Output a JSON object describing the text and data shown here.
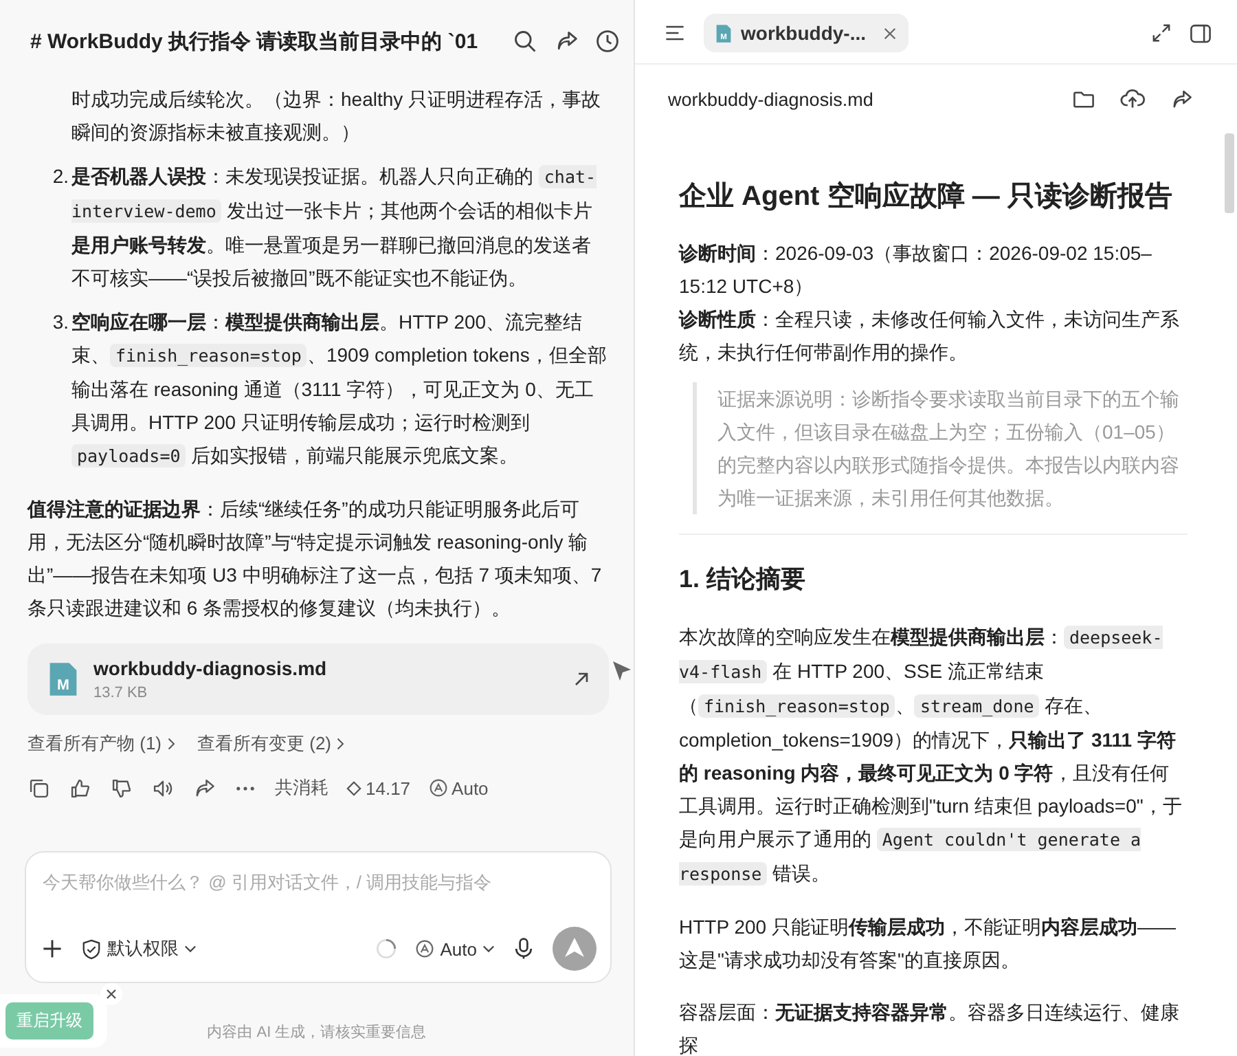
{
  "chat": {
    "title": "# WorkBuddy 执行指令 请读取当前目录中的 `01",
    "list": [
      {
        "segments": [
          {
            "kind": "text",
            "text": "时成功完成后续轮次。（边界：healthy 只证明进程存活，事故瞬间的资源指标未被直接观测。）"
          }
        ]
      },
      {
        "number": "2.",
        "segments": [
          {
            "kind": "text",
            "text": "**是否机器人误投**：未发现误投证据。机器人只向正确的 "
          },
          {
            "kind": "code",
            "text": "chat-interview-demo"
          },
          {
            "kind": "text",
            "text": " 发出过一张卡片；其他两个会话的相似卡片**是用户账号转发**。唯一悬置项是另一群聊已撤回消息的发送者不可核实——“误投后被撤回”既不能证实也不能证伪。"
          }
        ]
      },
      {
        "number": "3.",
        "segments": [
          {
            "kind": "text",
            "text": "**空响应在哪一层**：**模型提供商输出层**。HTTP 200、流完整结束、"
          },
          {
            "kind": "code",
            "text": "finish_reason=stop"
          },
          {
            "kind": "text",
            "text": "、1909 completion tokens，但全部输出落在 reasoning 通道（3111 字符），可见正文为 0、无工具调用。HTTP 200 只证明传输层成功；运行时检测到 "
          },
          {
            "kind": "code",
            "text": "payloads=0"
          },
          {
            "kind": "text",
            "text": " 后如实报错，前端只能展示兜底文案。"
          }
        ]
      }
    ],
    "paragraph": "**值得注意的证据边界**：后续“继续任务”的成功只能证明服务此后可用，无法区分“随机瞬时故障”与“特定提示词触发 reasoning-only 输出”——报告在未知项 U3 中明确标注了这一点，包括 7 项未知项、7 条只读跟进建议和 6 条需授权的修复建议（均未执行）。",
    "attachment": {
      "badge": "M",
      "name": "workbuddy-diagnosis.md",
      "size": "13.7 KB"
    },
    "links": [
      "查看所有产物 (1)",
      "查看所有变更 (2)"
    ],
    "usage": {
      "label": "共消耗",
      "cost": "14.17",
      "model": "Auto"
    }
  },
  "composer": {
    "placeholder": "今天帮你做些什么？ @ 引用对话文件，/ 调用技能与指令",
    "permission": "默认权限",
    "model": "Auto"
  },
  "footer_note": "内容由 AI 生成，请核实重要信息",
  "toast": {
    "button": "重启升级"
  },
  "preview": {
    "tabs": [
      {
        "badge": "M",
        "label": "workbuddy-...",
        "selected": true
      }
    ],
    "file_name": "workbuddy-diagnosis.md",
    "doc": [
      {
        "kind": "h1",
        "segments": [
          {
            "kind": "text",
            "text": "企业 Agent 空响应故障 — 只读诊断报告"
          }
        ]
      },
      {
        "kind": "meta",
        "segments": [
          {
            "kind": "text",
            "text": "**诊断时间**：2026-09-03（事故窗口：2026-09-02 15:05–15:12 UTC+8）"
          }
        ]
      },
      {
        "kind": "meta",
        "segments": [
          {
            "kind": "text",
            "text": "**诊断性质**：全程只读，未修改任何输入文件，未访问生产系统，未执行任何带副作用的操作。"
          }
        ]
      },
      {
        "kind": "quote",
        "segments": [
          {
            "kind": "text",
            "text": "证据来源说明：诊断指令要求读取当前目录下的五个输入文件，但该目录在磁盘上为空；五份输入（01–05）的完整内容以内联形式随指令提供。本报告以内联内容为唯一证据来源，未引用任何其他数据。"
          }
        ]
      },
      {
        "kind": "hr"
      },
      {
        "kind": "h2",
        "segments": [
          {
            "kind": "text",
            "text": "1. 结论摘要"
          }
        ]
      },
      {
        "kind": "p",
        "segments": [
          {
            "kind": "text",
            "text": "本次故障的空响应发生在**模型提供商输出层**："
          },
          {
            "kind": "code",
            "text": "deepseek-v4-flash"
          },
          {
            "kind": "text",
            "text": " 在 HTTP 200、SSE 流正常结束（"
          },
          {
            "kind": "code",
            "text": "finish_reason=stop"
          },
          {
            "kind": "text",
            "text": "、"
          },
          {
            "kind": "code",
            "text": "stream_done"
          },
          {
            "kind": "text",
            "text": " 存在、completion_tokens=1909）的情况下，**只输出了 3111 字符的 reasoning 内容，最终可见正文为 0 字符**，且没有任何工具调用。运行时正确检测到\"turn 结束但 payloads=0\"，于是向用户展示了通用的 "
          },
          {
            "kind": "code",
            "text": "Agent couldn't generate a response"
          },
          {
            "kind": "text",
            "text": " 错误。"
          }
        ]
      },
      {
        "kind": "p",
        "segments": [
          {
            "kind": "text",
            "text": "HTTP 200 只能证明**传输层成功**，不能证明**内容层成功**——这是\"请求成功却没有答案\"的直接原因。"
          }
        ]
      },
      {
        "kind": "p",
        "segments": [
          {
            "kind": "text",
            "text": "容器层面：**无证据支持容器异常**。容器多日连续运行、健康探"
          }
        ]
      }
    ]
  }
}
